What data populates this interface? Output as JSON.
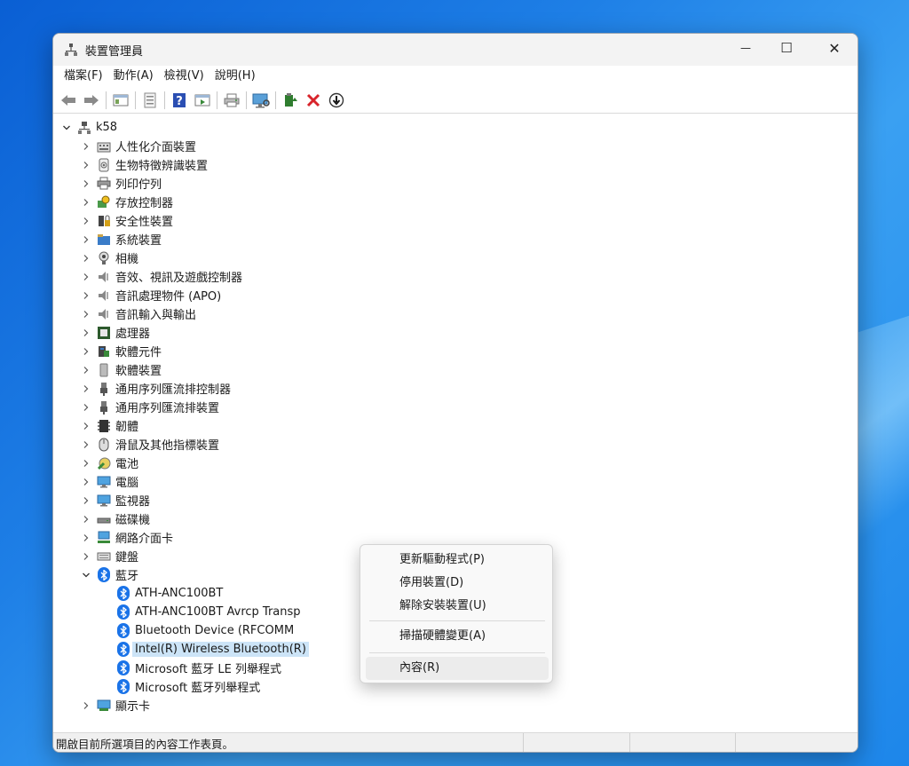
{
  "window": {
    "title": "裝置管理員",
    "caption": {
      "minimize": "—",
      "maximize": "☐",
      "close": "✕"
    }
  },
  "menubar": [
    "檔案(F)",
    "動作(A)",
    "檢視(V)",
    "說明(H)"
  ],
  "toolbar": [
    "back-icon",
    "forward-icon",
    "show-hide-console-tree-icon",
    "properties-icon",
    "help-icon",
    "run-icon",
    "print-icon",
    "scan-hardware-icon",
    "enable-device-icon",
    "uninstall-icon",
    "disable-device-icon"
  ],
  "tree": {
    "root": "k58",
    "categories": [
      {
        "label": "人性化介面裝置",
        "icon": "hid-icon"
      },
      {
        "label": "生物特徵辨識裝置",
        "icon": "biometric-icon"
      },
      {
        "label": "列印佇列",
        "icon": "printer-icon"
      },
      {
        "label": "存放控制器",
        "icon": "storage-controller-icon"
      },
      {
        "label": "安全性裝置",
        "icon": "security-device-icon"
      },
      {
        "label": "系統裝置",
        "icon": "system-device-icon"
      },
      {
        "label": "相機",
        "icon": "camera-icon"
      },
      {
        "label": "音效、視訊及遊戲控制器",
        "icon": "sound-icon"
      },
      {
        "label": "音訊處理物件 (APO)",
        "icon": "audio-processing-icon"
      },
      {
        "label": "音訊輸入與輸出",
        "icon": "audio-io-icon"
      },
      {
        "label": "處理器",
        "icon": "processor-icon"
      },
      {
        "label": "軟體元件",
        "icon": "software-component-icon"
      },
      {
        "label": "軟體裝置",
        "icon": "software-device-icon"
      },
      {
        "label": "通用序列匯流排控制器",
        "icon": "usb-controller-icon"
      },
      {
        "label": "通用序列匯流排裝置",
        "icon": "usb-device-icon"
      },
      {
        "label": "韌體",
        "icon": "firmware-icon"
      },
      {
        "label": "滑鼠及其他指標裝置",
        "icon": "mouse-icon"
      },
      {
        "label": "電池",
        "icon": "battery-icon"
      },
      {
        "label": "電腦",
        "icon": "computer-icon"
      },
      {
        "label": "監視器",
        "icon": "monitor-icon"
      },
      {
        "label": "磁碟機",
        "icon": "disk-drive-icon"
      },
      {
        "label": "網路介面卡",
        "icon": "network-adapter-icon"
      },
      {
        "label": "鍵盤",
        "icon": "keyboard-icon"
      },
      {
        "label": "藍牙",
        "icon": "bluetooth-icon"
      }
    ],
    "bluetooth_children": [
      "ATH-ANC100BT",
      "ATH-ANC100BT Avrcp Transp",
      "Bluetooth Device (RFCOMM",
      "Intel(R) Wireless Bluetooth(R)",
      "Microsoft 藍牙 LE 列舉程式",
      "Microsoft 藍牙列舉程式"
    ],
    "last_category": {
      "label": "顯示卡",
      "icon": "display-adapter-icon"
    }
  },
  "context_menu": {
    "items": [
      "更新驅動程式(P)",
      "停用裝置(D)",
      "解除安裝裝置(U)",
      "掃描硬體變更(A)",
      "內容(R)"
    ]
  },
  "statusbar": {
    "text": "開啟目前所選項目的內容工作表頁。"
  }
}
